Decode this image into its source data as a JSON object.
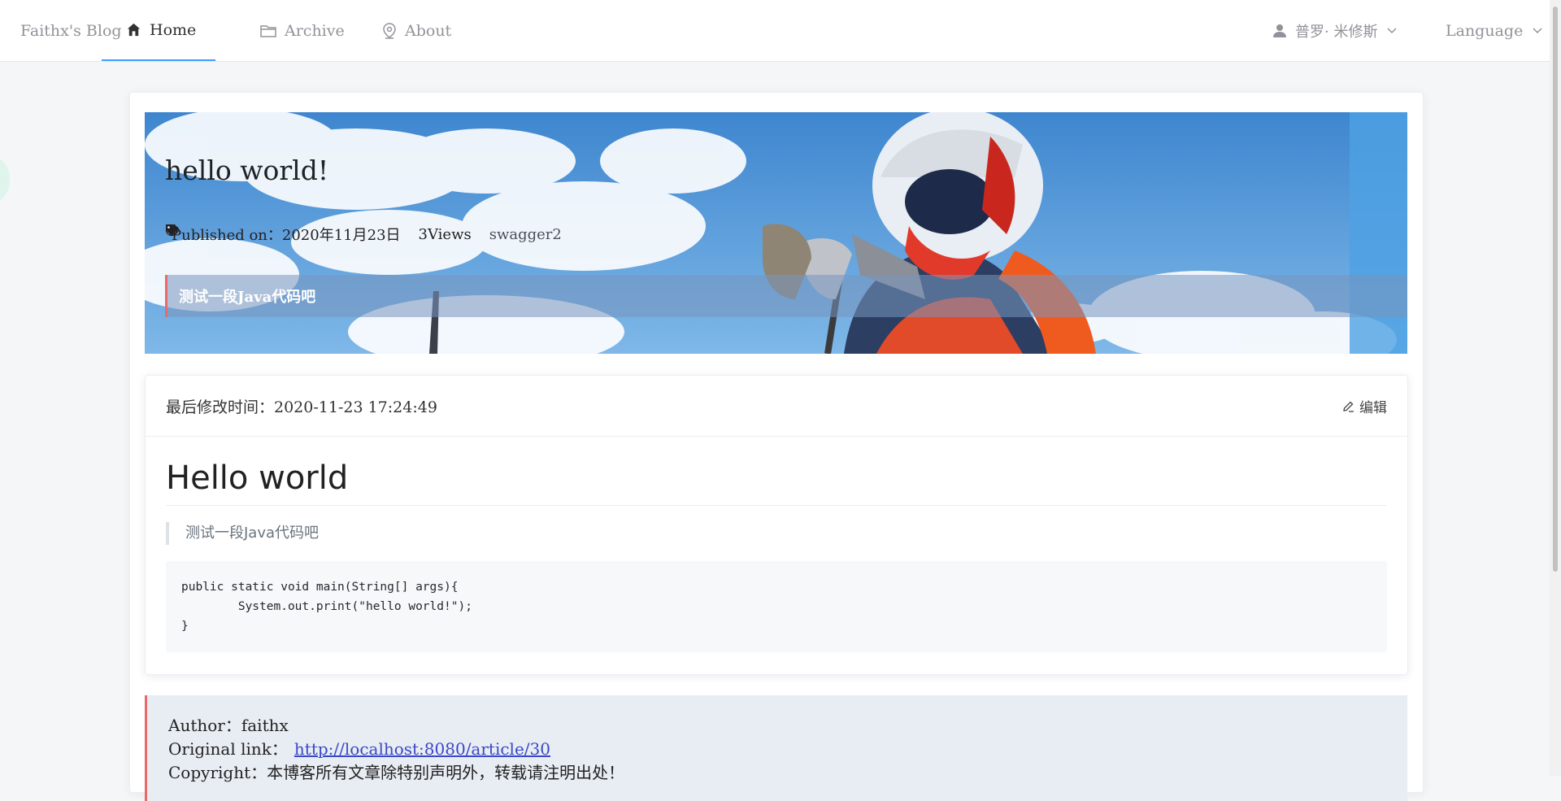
{
  "nav": {
    "brand": "Faithx's Blog",
    "items": [
      {
        "label": "Home",
        "icon": "home-icon"
      },
      {
        "label": "Archive",
        "icon": "folder-icon"
      },
      {
        "label": "About",
        "icon": "location-pin-icon"
      }
    ],
    "user": "普罗· 米修斯",
    "language": "Language"
  },
  "banner": {
    "title": "hello world!",
    "published_label": "Published on：",
    "published_date": "2020年11月23日",
    "views": "3Views",
    "tag": "swagger2",
    "summary": "测试一段Java代码吧"
  },
  "article": {
    "modified": "最后修改时间：2020-11-23 17:24:49",
    "edit_label": "编辑",
    "heading": "Hello world",
    "quote": "测试一段Java代码吧",
    "code": "public static void main(String[] args){\n        System.out.print(\"hello world!\");\n}"
  },
  "copyright": {
    "author": "Author：faithx",
    "link_label": "Original link：",
    "link": "http://localhost:8080/article/30",
    "notice": "Copyright：本博客所有文章除特别声明外，转载请注明出处！"
  },
  "colors": {
    "accent": "#409eff",
    "quote_border": "#e86a6a",
    "link": "#3a48c7"
  }
}
